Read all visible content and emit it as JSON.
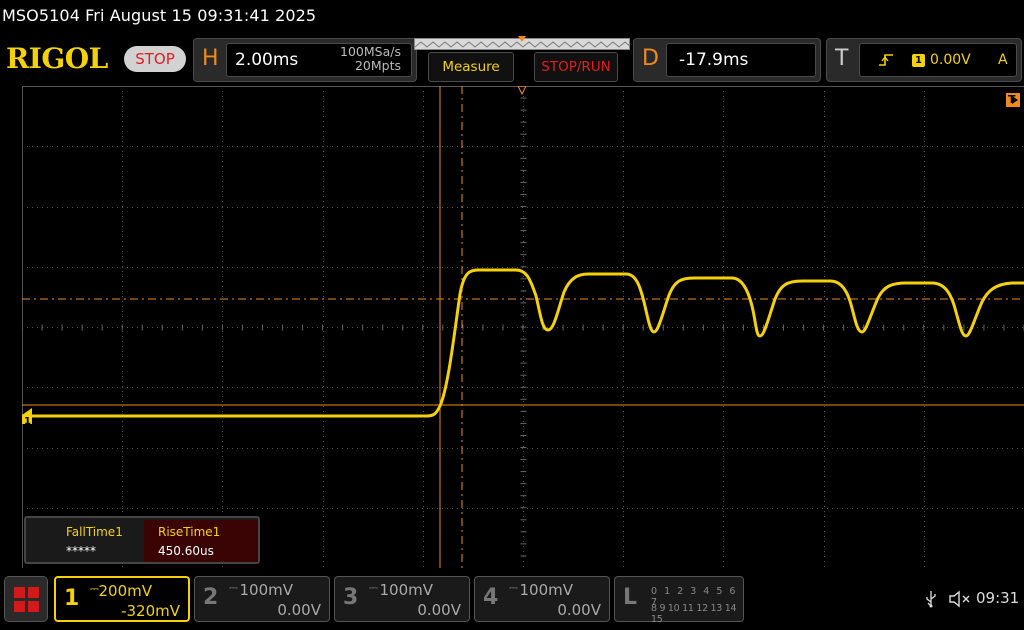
{
  "title_bar": {
    "text": "MSO5104  Fri August 15 09:31:41 2025"
  },
  "brand": {
    "logo": "RIGOL",
    "run_state": "STOP"
  },
  "horizontal": {
    "letter": "H",
    "time_scale": "2.00ms",
    "sample_rate": "100MSa/s",
    "memory_depth": "20Mpts"
  },
  "buttons": {
    "measure": "Measure",
    "stop_run": "STOP/RUN"
  },
  "delay": {
    "letter": "D",
    "value": "-17.9ms"
  },
  "trigger": {
    "letter": "T",
    "edge_icon": "rising-edge-icon",
    "channel": "1",
    "level": "0.00V",
    "mode": "A"
  },
  "display": {
    "channel_marker": "1",
    "trigger_position_marker": "T",
    "waveform_color": "#f5d10a",
    "cursor_color": "#f08a1e"
  },
  "measurements": [
    {
      "name": "FallTime1",
      "value": "*****"
    },
    {
      "name": "RiseTime1",
      "value": "450.60us"
    }
  ],
  "channels": [
    {
      "num": "1",
      "coupling_icon": "dc-coupling-icon",
      "scale": "200mV",
      "offset": "-320mV",
      "active": true
    },
    {
      "num": "2",
      "coupling_icon": "dc-coupling-icon",
      "scale": "100mV",
      "offset": "0.00V",
      "active": false
    },
    {
      "num": "3",
      "coupling_icon": "dc-coupling-icon",
      "scale": "100mV",
      "offset": "0.00V",
      "active": false
    },
    {
      "num": "4",
      "coupling_icon": "dc-coupling-icon",
      "scale": "100mV",
      "offset": "0.00V",
      "active": false
    }
  ],
  "logic": {
    "letter": "L",
    "row1": "0 1 2 3  4 5 6 7",
    "row2": "8 9 10 11 12 13 14 15"
  },
  "status": {
    "usb_icon": "usb-icon",
    "sound_icon": "mute-icon",
    "time": "09:31"
  },
  "colors": {
    "accent": "#f5d10a",
    "h_letter": "#f08a1e",
    "stop": "#e21d1d"
  }
}
